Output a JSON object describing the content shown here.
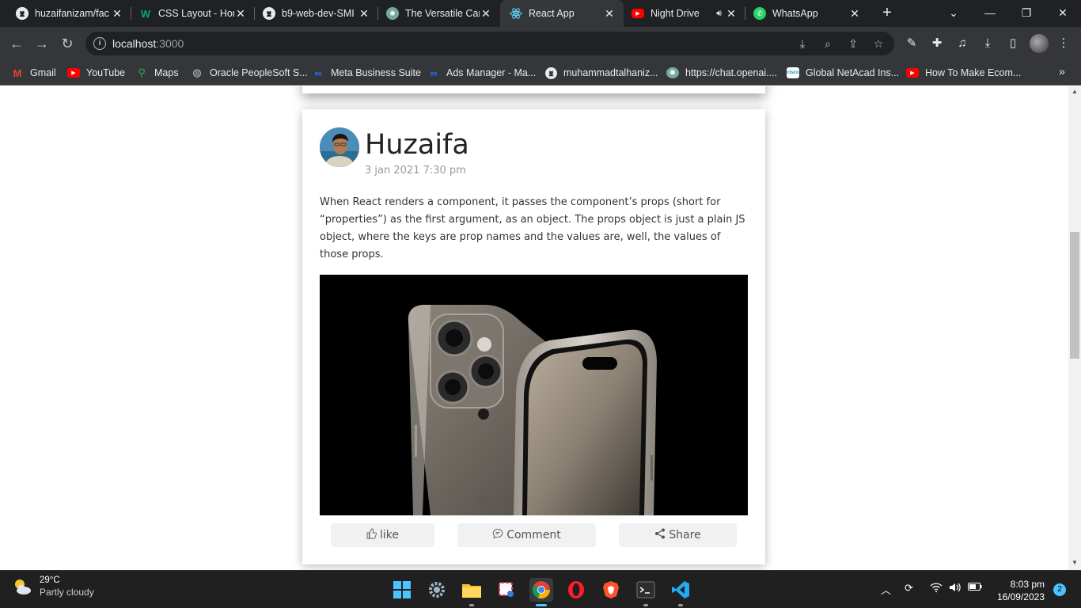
{
  "browser": {
    "tabs": [
      {
        "title": "huzaifanizam/fac",
        "icon": "github-icon"
      },
      {
        "title": "CSS Layout - Hor",
        "icon": "w3schools-icon"
      },
      {
        "title": "b9-web-dev-SMI",
        "icon": "github-icon"
      },
      {
        "title": "The Versatile Car",
        "icon": "chatgpt-icon"
      },
      {
        "title": "React App",
        "icon": "react-icon",
        "active": true
      },
      {
        "title": "Night Drive",
        "icon": "youtube-icon",
        "audio": true
      },
      {
        "title": "WhatsApp",
        "icon": "whatsapp-icon"
      }
    ],
    "url_host": "localhost",
    "url_port": ":3000",
    "bookmarks": [
      {
        "label": "Gmail",
        "icon": "gmail-icon"
      },
      {
        "label": "YouTube",
        "icon": "youtube-icon"
      },
      {
        "label": "Maps",
        "icon": "maps-icon"
      },
      {
        "label": "Oracle PeopleSoft S...",
        "icon": "globe-icon"
      },
      {
        "label": "Meta Business Suite",
        "icon": "meta-icon"
      },
      {
        "label": "Ads Manager - Ma...",
        "icon": "meta-icon"
      },
      {
        "label": "muhammadtalhaniz...",
        "icon": "github-icon"
      },
      {
        "label": "https://chat.openai....",
        "icon": "chatgpt-icon"
      },
      {
        "label": "Global NetAcad Ins...",
        "icon": "cisco-icon"
      },
      {
        "label": "How To Make Ecom...",
        "icon": "youtube-icon"
      }
    ]
  },
  "post": {
    "author": "Huzaifa",
    "date": "3 jan 2021 7:30 pm",
    "body": "When React renders a component, it passes the component’s props (short for “properties”) as the first argument, as an object. The props object is just a plain JS object, where the keys are prop names and the values are, well, the values of those props.",
    "like_label": "like",
    "comment_label": "Comment",
    "share_label": "Share"
  },
  "taskbar": {
    "temperature": "29°C",
    "condition": "Partly cloudy",
    "time": "8:03 pm",
    "date": "16/09/2023",
    "notifications": "2"
  },
  "colors": {
    "chrome_dark": "#202124",
    "chrome_toolbar": "#35363a",
    "accent": "#4cc2ff"
  }
}
